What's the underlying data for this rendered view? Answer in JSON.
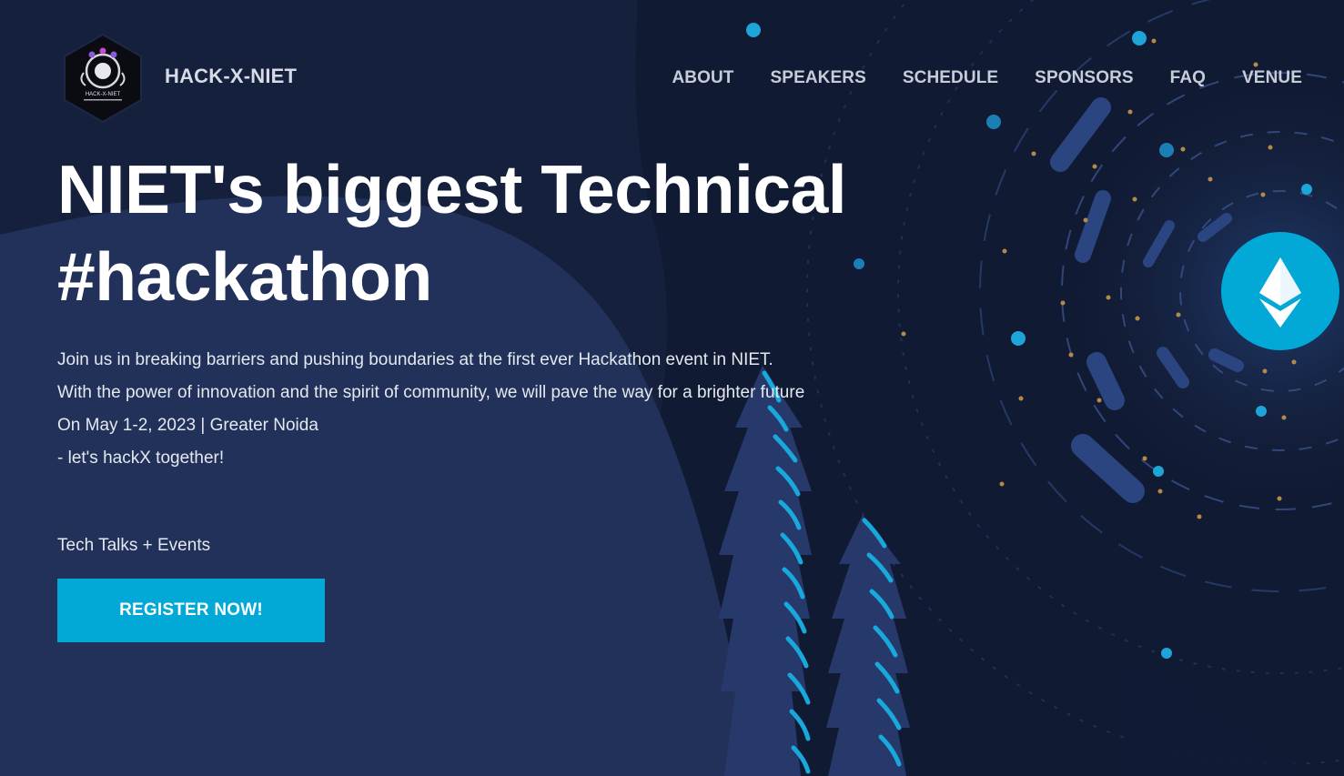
{
  "brand": {
    "name": "HACK-X-NIET",
    "logo_text": "HACK-X-NIET"
  },
  "nav": {
    "items": [
      "ABOUT",
      "SPEAKERS",
      "SCHEDULE",
      "SPONSORS",
      "FAQ",
      "VENUE"
    ]
  },
  "hero": {
    "title_line1": "NIET's biggest Technical",
    "title_line2": "#hackathon",
    "description": [
      "Join us in breaking barriers and pushing boundaries at the first ever Hackathon event in NIET.",
      "With the power of innovation and the spirit of community, we will pave the way for a brighter future",
      "On May 1-2, 2023 | Greater Noida",
      "- let's hackX together!"
    ],
    "tagline": "Tech Talks + Events",
    "cta_label": "REGISTER NOW!"
  },
  "colors": {
    "background": "#15203d",
    "hill": "#213159",
    "accent": "#02a8d6",
    "tree": "#27396a",
    "dot_gold": "#b48a4a"
  },
  "icons": {
    "hero_badge": "ethereum-icon"
  }
}
